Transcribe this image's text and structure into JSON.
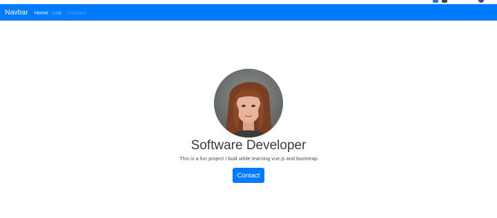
{
  "navbar": {
    "brand": "Navbar",
    "links": [
      {
        "label": "Home",
        "state": "active"
      },
      {
        "label": "Link",
        "state": "normal"
      },
      {
        "label": "Disabled",
        "state": "disabled"
      }
    ],
    "background_color": "#007bff"
  },
  "hero": {
    "avatar_icon": "profile-photo",
    "title": "Software Developer",
    "subtitle": "This is a fun project I built while learning vue.js and bootstrap",
    "button_label": "Contact",
    "button_color": "#007bff"
  }
}
